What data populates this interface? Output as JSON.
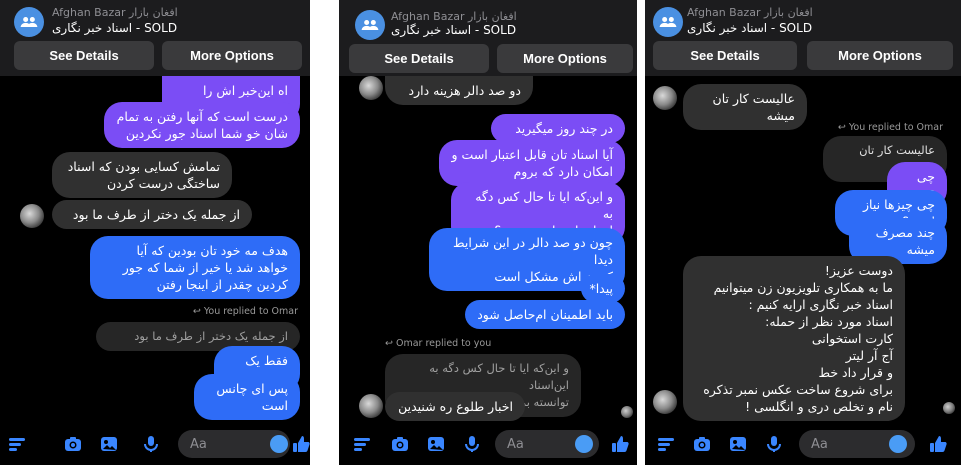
{
  "header": {
    "title_top": "Afghan Bazar افغان بازار",
    "title_main": "اسناد خبر نگاری - SOLD",
    "see_details": "See Details",
    "more_options": "More Options"
  },
  "composer": {
    "placeholder": "Aa"
  },
  "panel1": {
    "m1": "اه این‌خبر اش را شنیدم",
    "m2": "درست است که آنها رفتن به تمام\nشان خو شما اسناد جور نکردین",
    "m3": "تمامش کسایی بودن که اسناد\nساختگی درست کردن",
    "m4": "از جمله یک دختر از طرف ما بود",
    "m5": "هدف مه خود تان بودین که آیا\nخواهد شد یا خیر از شما که جور\nکردین چقدر از اینجا رفتن",
    "replied": "You replied to Omar",
    "quoted": "از جمله یک دختر از طرف ما بود",
    "m6": "فقط یک نفر",
    "m7": "پس ای چانس است"
  },
  "panel2": {
    "m1": "دو صد دالر هزینه دارد",
    "m2": "در چند روز میگیرید",
    "m3": "آیا اسناد تان قابل اعتبار است و\nامکان دارد که بروم",
    "m4": "و این‌که ایا تا حال کس دگه به\nاین‌اسناد توانسته برود؟",
    "m5": "چون دو صد دالر در این شرایط دیدا\nکردن اش مشکل است",
    "m6": "پیدا*",
    "m7": "باید اطمینان ام‌حاصل شود",
    "replied": "Omar replied to you",
    "quoted": "و این‌که ایا تا حال کس دگه به این‌اسناد\nتوانسته برود؟",
    "m8": "اخبار طلوع ره شنیدین"
  },
  "panel3": {
    "m1": "عالیست کار تان میشه",
    "replied": "You replied to Omar",
    "quoted": "عالیست کار تان میشه",
    "m2": "چی قسم",
    "m3": "چی چیزها نیاز است؟",
    "m4": "چند مصرف میشه",
    "m5": "دوست عزیز!\nما به همکاری تلویزیون زن میتوانیم\nاسناد خبر نگاری ارایه کنیم :\nاسناد مورد نظر از حمله:\nکارت استخوانی\nآج آر لیتر\nو قرار داد خط\nبرای شروع ساخت عکس نمبر تذکره\nنام و تخلص دری و انگلسی !"
  },
  "colors": {
    "outgoing_purple": "#7b4df5",
    "outgoing_blue": "#2e6cf7",
    "incoming": "#303030",
    "icon_blue": "#4a9cf5"
  }
}
